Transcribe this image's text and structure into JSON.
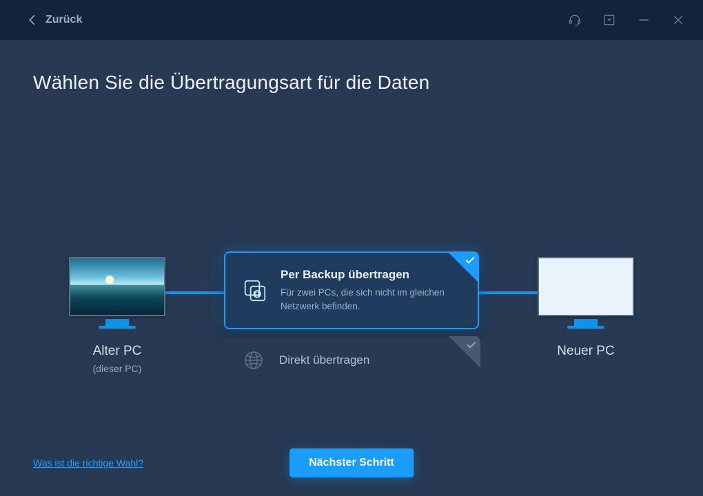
{
  "titlebar": {
    "back_label": "Zurück",
    "icons": {
      "headset": "headset-icon",
      "dropdown": "dropdown-icon",
      "minimize": "minimize-icon",
      "close": "close-icon"
    }
  },
  "heading": "Wählen Sie die Übertragungsart für die Daten",
  "pcs": {
    "old": {
      "label": "Alter PC",
      "sub": "(dieser PC)"
    },
    "new": {
      "label": "Neuer PC"
    }
  },
  "options": [
    {
      "id": "backup",
      "title": "Per Backup übertragen",
      "desc": "Für zwei PCs, die sich nicht im gleichen Netzwerk befinden.",
      "selected": true,
      "icon": "transfer-backup-icon"
    },
    {
      "id": "direct",
      "title": "Direkt übertragen",
      "desc": "",
      "selected": false,
      "icon": "globe-icon"
    }
  ],
  "footer": {
    "help_link": "Was ist die richtige Wahl?",
    "next_button": "Nächster Schritt"
  },
  "colors": {
    "accent": "#1b9cff",
    "bg": "#273953",
    "titlebar": "#13233a"
  }
}
